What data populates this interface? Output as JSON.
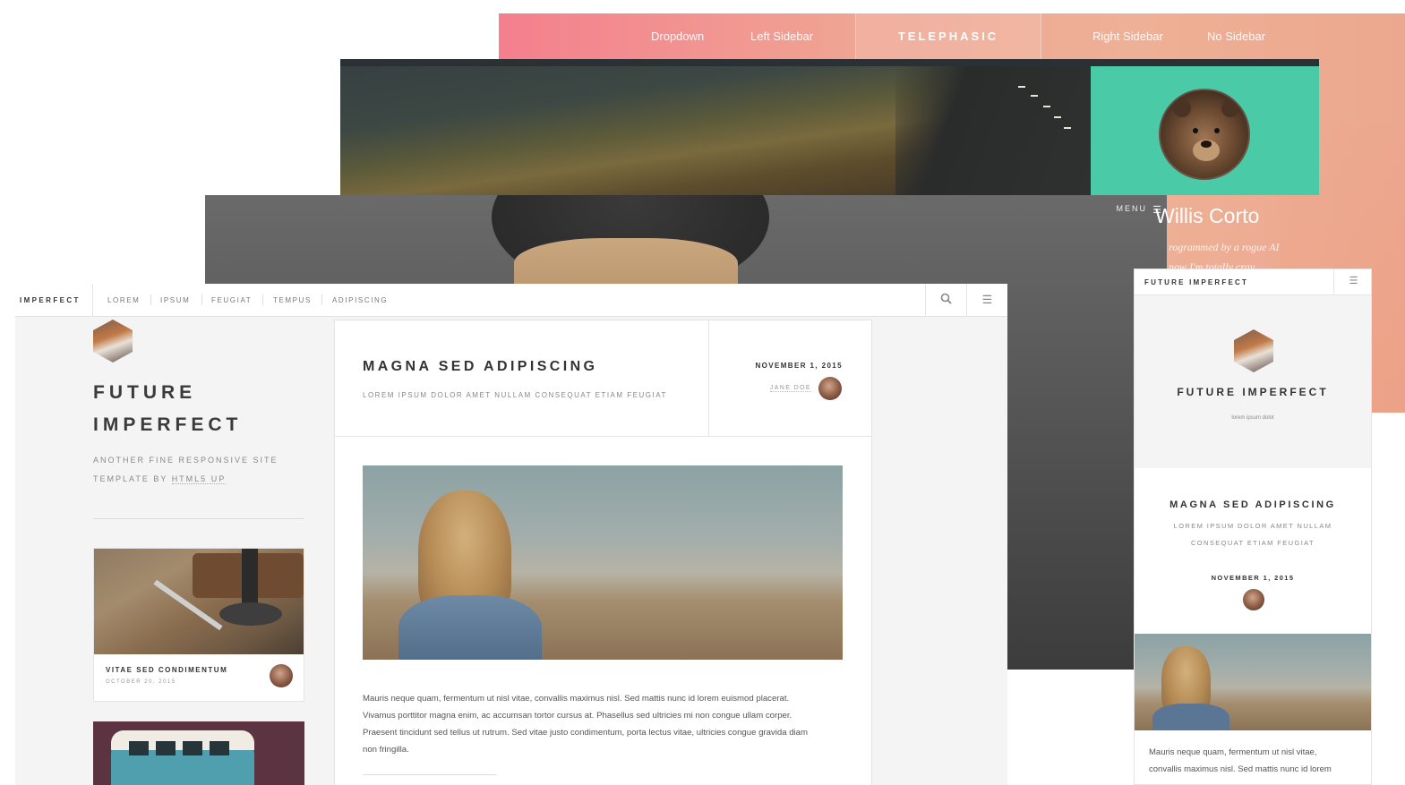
{
  "telephasic": {
    "nav": [
      "Dropdown",
      "Left Sidebar",
      "Right Sidebar",
      "No Sidebar"
    ],
    "logo": "TELEPHASIC"
  },
  "profile": {
    "name": "Willis Corto",
    "tagline1": "rogrammed by a rogue AI",
    "tagline2": "now I'm totally cray"
  },
  "gray_site": {
    "menu_label": "MENU"
  },
  "desktop": {
    "logo": "IMPERFECT",
    "nav": [
      "LOREM",
      "IPSUM",
      "FEUGIAT",
      "TEMPUS",
      "ADIPISCING"
    ],
    "site_title_line1": "FUTURE",
    "site_title_line2": "IMPERFECT",
    "tagline_line1": "ANOTHER FINE RESPONSIVE SITE",
    "tagline_line2_prefix": "TEMPLATE BY ",
    "tagline_link": "HTML5 UP",
    "mini_post": {
      "title": "VITAE SED CONDIMENTUM",
      "date": "OCTOBER 20, 2015"
    },
    "post": {
      "title": "MAGNA SED ADIPISCING",
      "subtitle": "LOREM IPSUM DOLOR AMET NULLAM CONSEQUAT ETIAM FEUGIAT",
      "date": "NOVEMBER 1, 2015",
      "author": "JANE DOE",
      "body_lines": [
        "Mauris neque quam, fermentum ut nisl vitae, convallis maximus nisl. Sed mattis nunc id lorem euismod placerat.",
        "Vivamus porttitor magna enim, ac accumsan tortor cursus at. Phasellus sed ultricies mi non congue ullam corper.",
        "Praesent tincidunt sed tellus ut rutrum. Sed vitae justo condimentum, porta lectus vitae, ultricies congue gravida diam",
        "non fringilla."
      ]
    }
  },
  "mobile": {
    "logo": "FUTURE IMPERFECT",
    "title": "FUTURE IMPERFECT",
    "subtitle": "lorem ipsum dolot",
    "post": {
      "title": "MAGNA SED ADIPISCING",
      "subtitle_line1": "LOREM IPSUM DOLOR AMET NULLAM",
      "subtitle_line2": "CONSEQUAT ETIAM FEUGIAT",
      "date": "NOVEMBER 1, 2015",
      "body_lines": [
        "Mauris neque quam, fermentum ut nisl vitae,",
        "convallis maximus nisl. Sed mattis nunc id lorem"
      ]
    }
  },
  "icons": {
    "search": "search-icon",
    "menu": "hamburger-icon"
  },
  "colors": {
    "telephasic_gradient_start": "#f47f8e",
    "telephasic_gradient_end": "#eca88f",
    "teal_sidebar": "#4acaa7",
    "imperfect_background": "#f4f4f4"
  }
}
